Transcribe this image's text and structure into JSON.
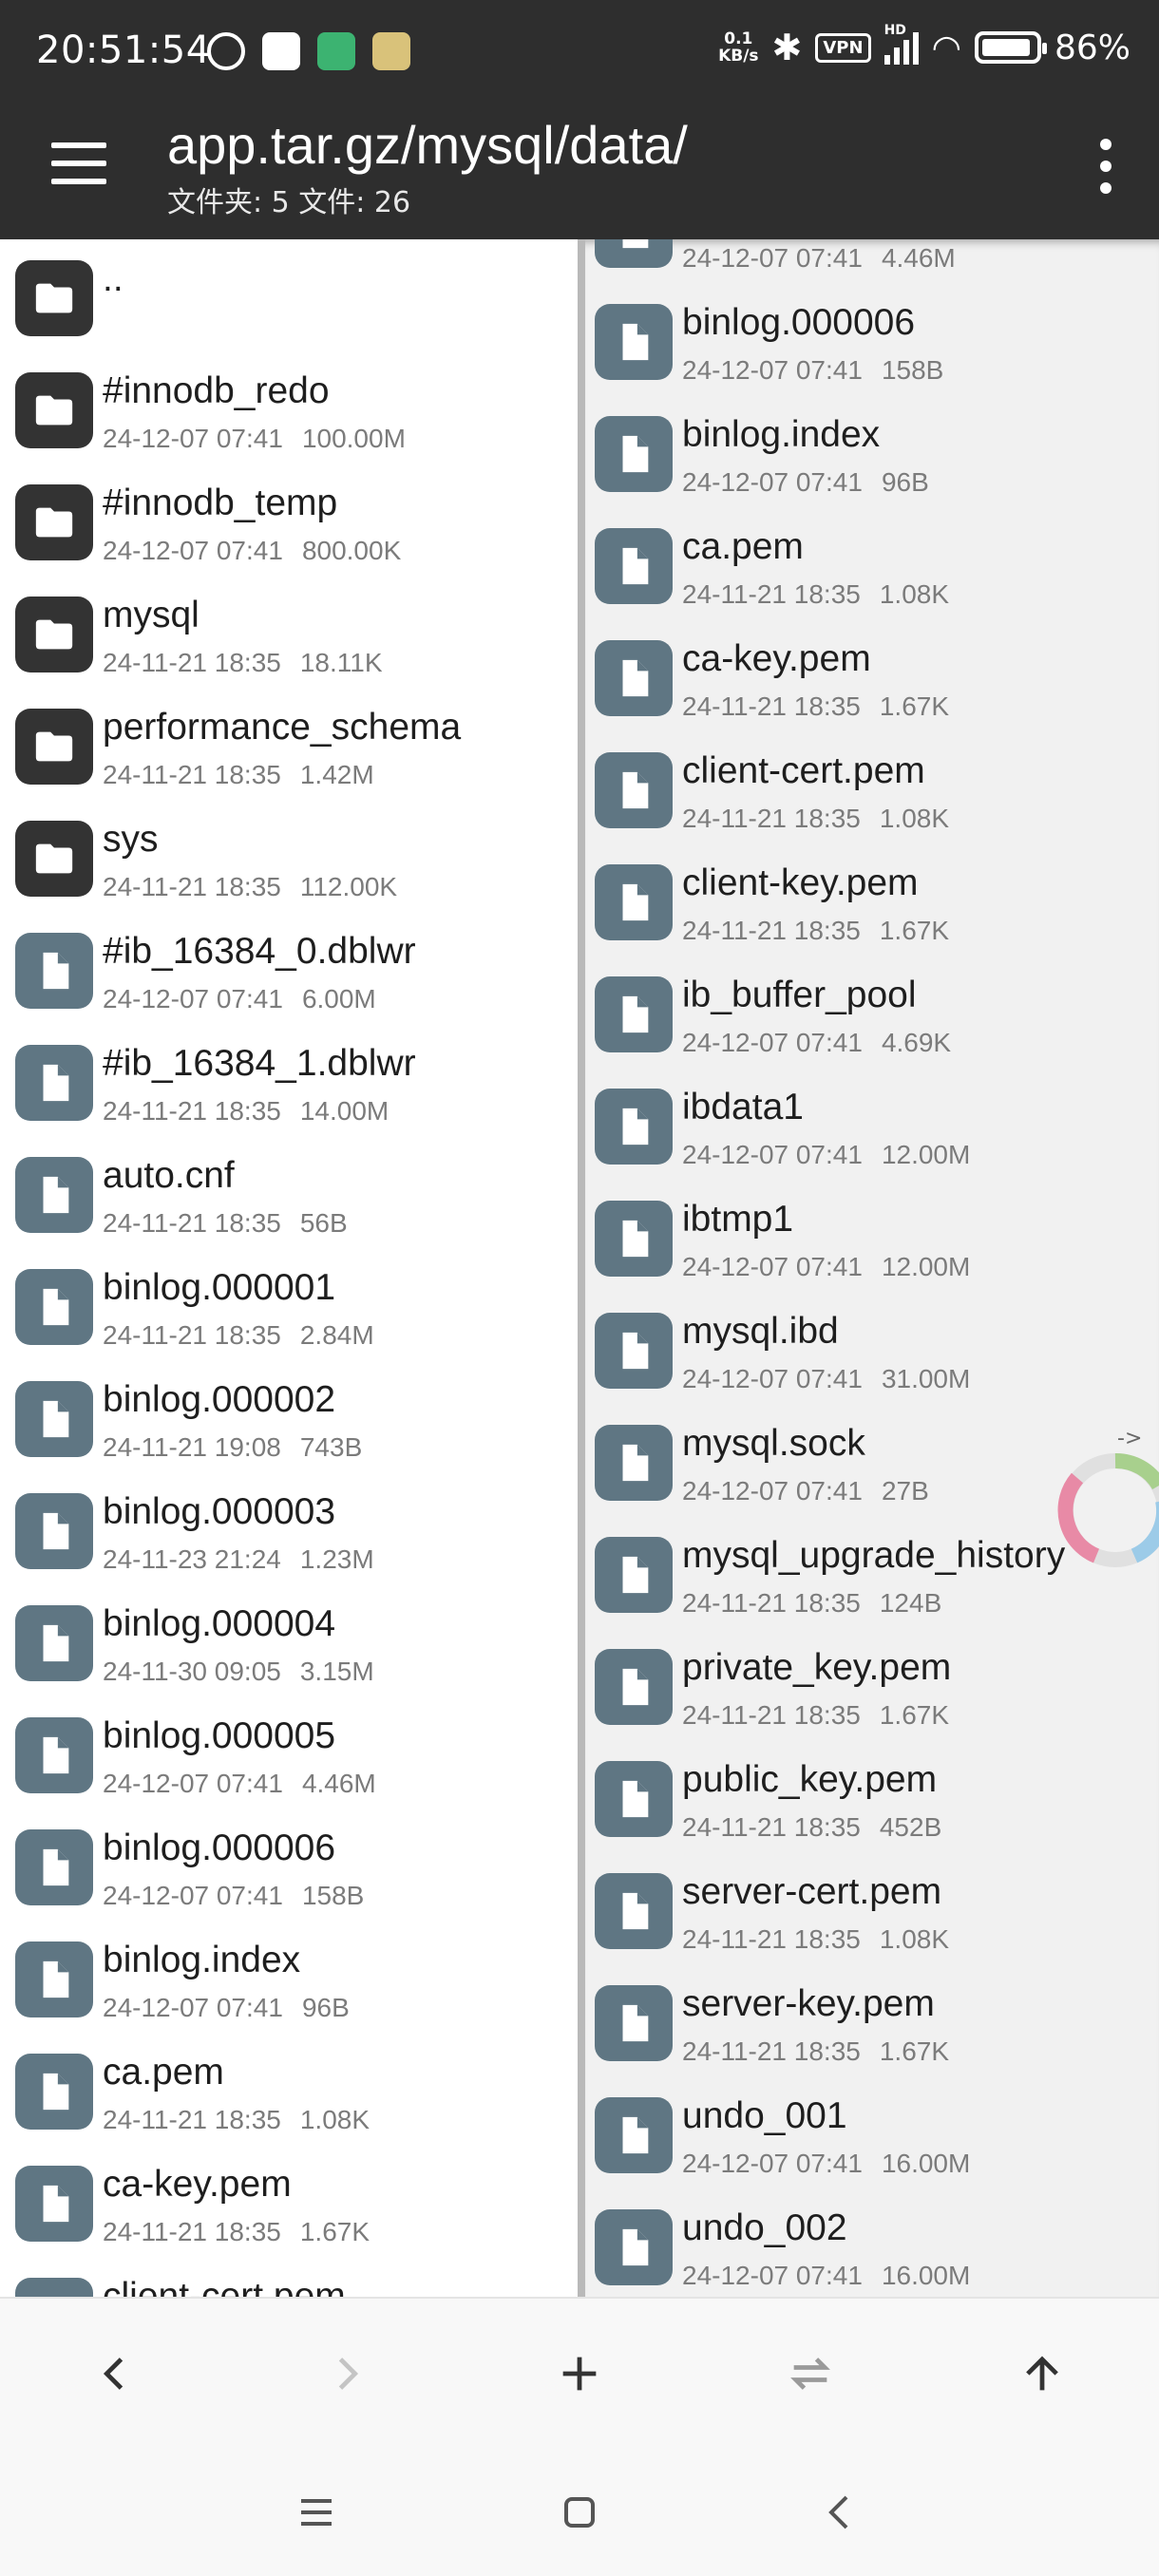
{
  "status": {
    "time": "20:51:54",
    "net_value": "0.1",
    "net_unit": "KB/s",
    "vpn": "VPN",
    "hd": "HD",
    "battery": "86%"
  },
  "appbar": {
    "title": "app.tar.gz/mysql/data/",
    "subtitle": "文件夹: 5  文件: 26"
  },
  "left_pane": {
    "items": [
      {
        "name": "..",
        "date": "",
        "size": "",
        "kind": "folder"
      },
      {
        "name": "#innodb_redo",
        "date": "24-12-07 07:41",
        "size": "100.00M",
        "kind": "folder"
      },
      {
        "name": "#innodb_temp",
        "date": "24-12-07 07:41",
        "size": "800.00K",
        "kind": "folder"
      },
      {
        "name": "mysql",
        "date": "24-11-21 18:35",
        "size": "18.11K",
        "kind": "folder"
      },
      {
        "name": "performance_schema",
        "date": "24-11-21 18:35",
        "size": "1.42M",
        "kind": "folder"
      },
      {
        "name": "sys",
        "date": "24-11-21 18:35",
        "size": "112.00K",
        "kind": "folder"
      },
      {
        "name": "#ib_16384_0.dblwr",
        "date": "24-12-07 07:41",
        "size": "6.00M",
        "kind": "file"
      },
      {
        "name": "#ib_16384_1.dblwr",
        "date": "24-11-21 18:35",
        "size": "14.00M",
        "kind": "file"
      },
      {
        "name": "auto.cnf",
        "date": "24-11-21 18:35",
        "size": "56B",
        "kind": "file"
      },
      {
        "name": "binlog.000001",
        "date": "24-11-21 18:35",
        "size": "2.84M",
        "kind": "file"
      },
      {
        "name": "binlog.000002",
        "date": "24-11-21 19:08",
        "size": "743B",
        "kind": "file"
      },
      {
        "name": "binlog.000003",
        "date": "24-11-23 21:24",
        "size": "1.23M",
        "kind": "file"
      },
      {
        "name": "binlog.000004",
        "date": "24-11-30 09:05",
        "size": "3.15M",
        "kind": "file"
      },
      {
        "name": "binlog.000005",
        "date": "24-12-07 07:41",
        "size": "4.46M",
        "kind": "file"
      },
      {
        "name": "binlog.000006",
        "date": "24-12-07 07:41",
        "size": "158B",
        "kind": "file"
      },
      {
        "name": "binlog.index",
        "date": "24-12-07 07:41",
        "size": "96B",
        "kind": "file"
      },
      {
        "name": "ca.pem",
        "date": "24-11-21 18:35",
        "size": "1.08K",
        "kind": "file"
      },
      {
        "name": "ca-key.pem",
        "date": "24-11-21 18:35",
        "size": "1.67K",
        "kind": "file"
      },
      {
        "name": "client-cert.pem",
        "date": "",
        "size": "",
        "kind": "file"
      }
    ]
  },
  "right_pane": {
    "items": [
      {
        "name": "",
        "date": "24-12-07 07:41",
        "size": "4.46M",
        "kind": "file"
      },
      {
        "name": "binlog.000006",
        "date": "24-12-07 07:41",
        "size": "158B",
        "kind": "file"
      },
      {
        "name": "binlog.index",
        "date": "24-12-07 07:41",
        "size": "96B",
        "kind": "file"
      },
      {
        "name": "ca.pem",
        "date": "24-11-21 18:35",
        "size": "1.08K",
        "kind": "file"
      },
      {
        "name": "ca-key.pem",
        "date": "24-11-21 18:35",
        "size": "1.67K",
        "kind": "file"
      },
      {
        "name": "client-cert.pem",
        "date": "24-11-21 18:35",
        "size": "1.08K",
        "kind": "file"
      },
      {
        "name": "client-key.pem",
        "date": "24-11-21 18:35",
        "size": "1.67K",
        "kind": "file"
      },
      {
        "name": "ib_buffer_pool",
        "date": "24-12-07 07:41",
        "size": "4.69K",
        "kind": "file"
      },
      {
        "name": "ibdata1",
        "date": "24-12-07 07:41",
        "size": "12.00M",
        "kind": "file"
      },
      {
        "name": "ibtmp1",
        "date": "24-12-07 07:41",
        "size": "12.00M",
        "kind": "file"
      },
      {
        "name": "mysql.ibd",
        "date": "24-12-07 07:41",
        "size": "31.00M",
        "kind": "file"
      },
      {
        "name": "mysql.sock",
        "date": "24-12-07 07:41",
        "size": "27B",
        "kind": "file"
      },
      {
        "name": "mysql_upgrade_history",
        "date": "24-11-21 18:35",
        "size": "124B",
        "kind": "file"
      },
      {
        "name": "private_key.pem",
        "date": "24-11-21 18:35",
        "size": "1.67K",
        "kind": "file"
      },
      {
        "name": "public_key.pem",
        "date": "24-11-21 18:35",
        "size": "452B",
        "kind": "file"
      },
      {
        "name": "server-cert.pem",
        "date": "24-11-21 18:35",
        "size": "1.08K",
        "kind": "file"
      },
      {
        "name": "server-key.pem",
        "date": "24-11-21 18:35",
        "size": "1.67K",
        "kind": "file"
      },
      {
        "name": "undo_001",
        "date": "24-12-07 07:41",
        "size": "16.00M",
        "kind": "file"
      },
      {
        "name": "undo_002",
        "date": "24-12-07 07:41",
        "size": "16.00M",
        "kind": "file"
      }
    ]
  },
  "floating": {
    "arrow": "->"
  },
  "colors": {
    "bar": "#2e2e2e",
    "folder_icon": "#333333",
    "file_icon": "#5f7683"
  },
  "icons": {
    "toolbar": [
      "back-arrow-icon",
      "forward-arrow-icon",
      "plus-icon",
      "swap-icon",
      "up-arrow-icon"
    ],
    "nav": [
      "menu-icon",
      "home-square-icon",
      "back-icon"
    ]
  }
}
